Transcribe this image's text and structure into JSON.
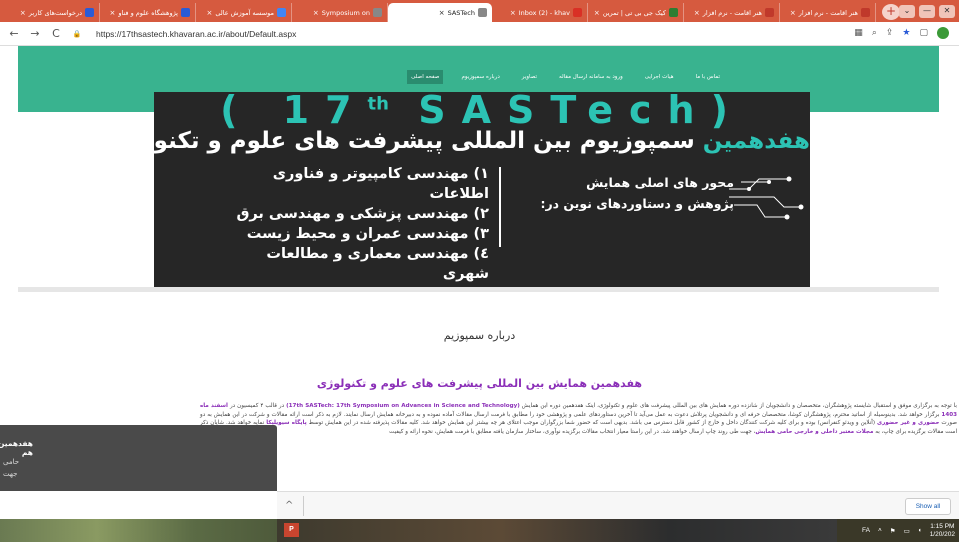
{
  "tabs": [
    {
      "title": "درخواست‌های کاربر",
      "close": "×",
      "color": "#2a5bd7",
      "active": false
    },
    {
      "title": "پژوهشگاه علوم و فناو",
      "close": "×",
      "color": "#2a5bd7",
      "active": false
    },
    {
      "title": "موسسه آموزش عالی",
      "close": "×",
      "color": "#4285f4",
      "active": false
    },
    {
      "title": "Symposium on",
      "close": "×",
      "color": "#888888",
      "active": false
    },
    {
      "title": "SASTech",
      "close": "×",
      "color": "#888888",
      "active": true
    },
    {
      "title": "Inbox (2) - khav",
      "close": "×",
      "color": "#d93025",
      "active": false
    },
    {
      "title": "کیک جی بی تی | تمرین",
      "close": "×",
      "color": "#2e7d32",
      "active": false
    },
    {
      "title": "هنر اقامت - نرم افزار",
      "close": "×",
      "color": "#c0392b",
      "active": false
    },
    {
      "title": "هنر اقامت - نرم افزار",
      "close": "×",
      "color": "#c0392b",
      "active": false
    }
  ],
  "newtab_label": "+",
  "window": {
    "restore": "⌄",
    "minimize": "—",
    "close": "✕"
  },
  "nav": {
    "back": "←",
    "forward": "→",
    "reload": "C",
    "lock": "🔒"
  },
  "address": {
    "url": "https://17thsastech.khavaran.ac.ir/about/Default.aspx"
  },
  "toolbar_icons": [
    "translate-icon",
    "zoom-icon",
    "share-icon",
    "star-icon",
    "sidebar-icon",
    "profile-icon"
  ],
  "site_menu": [
    {
      "label": "صفحه اصلی",
      "active": true
    },
    {
      "label": "درباره سمپوزیوم",
      "active": false
    },
    {
      "label": "تصاویر",
      "active": false
    },
    {
      "label": "ورود به سامانه ارسال مقاله",
      "active": false
    },
    {
      "label": "هیات اجرایی",
      "active": false
    },
    {
      "label": "تماس با ما",
      "active": false
    }
  ],
  "banner": {
    "title_main": "( 17",
    "title_sup": "th",
    "title_rest": " SASTech)",
    "subtitle_highlight": "هفدهمین",
    "subtitle_rest": " سمپوزیوم بین المللی پیشرفت های علوم و تکنولوژی",
    "topics": [
      "۱) مهندسی کامپیوتر و فناوری اطلاعات",
      "۲) مهندسی پزشکی و مهندسی برق",
      "۳) مهندسی عمران و محیط زیست",
      "٤) مهندسی معماری و مطالعات شهری"
    ],
    "axis_line1": "محور های اصلی همایش",
    "axis_line2": "پژوهش و دستاوردهای نوین در:"
  },
  "about_label": "درباره سمپوزیم",
  "section_heading": "هفدهمین همایش بین المللی پیشرفت های علوم و تکنولوژی",
  "paragraph": {
    "p1": "با توجه به برگزاری موفق و استقبال شایسته پژوهشگران، متخصصان و دانشجویان از شانزده دوره همایش های بین المللی پیشرفت های علوم و تکنولوژی، اینک هفدهمین دوره این همایش ",
    "p1_em": "(17th SASTech: 17th Symposium on Advances in Science and Technology)",
    "p2": " در قالب ۴ کمیسیون در ",
    "p2_em": "اسفند ماه 1403",
    "p3": " برگزار خواهد شد. بدینوسیله از اساتید محترم، پژوهشگران کوشا، متخصصان حرفه ای و دانشجویان پرتلاش دعوت به عمل می‌آید تا آخرین دستاوردهای علمی و پژوهشی خود را مطابق با فرمت ارسال مقالات آماده نموده و به دبیرخانه همایش ارسال نمایند. لازم به ذکر است ارائه مقالات و شرکت در این همایش به دو صورت ",
    "p3_em": "حضوری و غیر حضوری",
    "p4": " (آنلاین و ویدئو کنفرانس) بوده و برای کلیه شرکت کنندگان داخل و خارج از کشور قابل دسترس می باشد. بدیهی است که حضور شما بزرگواران موجب اعتلای هر چه بیشتر این همایش خواهد شد. کلیه مقالات پذیرفته شده در این همایش توسط ",
    "p4_em": "پایگاه سیویلیکا",
    "p5": " نمایه خواهد شد. شایان ذکر است مقالات برگزیده برای چاپ، به ",
    "p5_em": "مجلات معتبر داخلی و خارجی حامی همایش",
    "p6": "، جهت طی روند چاپ ارسال خواهند شد. در این راستا معیار انتخاب مقالات برگزیده نوآوری، ساختار سازمان یافته مطابق با فرمت همایش، نحوه ارائه و کیفیت"
  },
  "popup": {
    "title": "هفدهمین هم",
    "line2": "حامی",
    "line3": "جهت"
  },
  "downloads": {
    "chevron": "^",
    "show_all": "Show all"
  },
  "taskbar": {
    "ppt_label": "P",
    "lang": "FA",
    "time": "1:15 PM",
    "date": "1/20/202"
  }
}
